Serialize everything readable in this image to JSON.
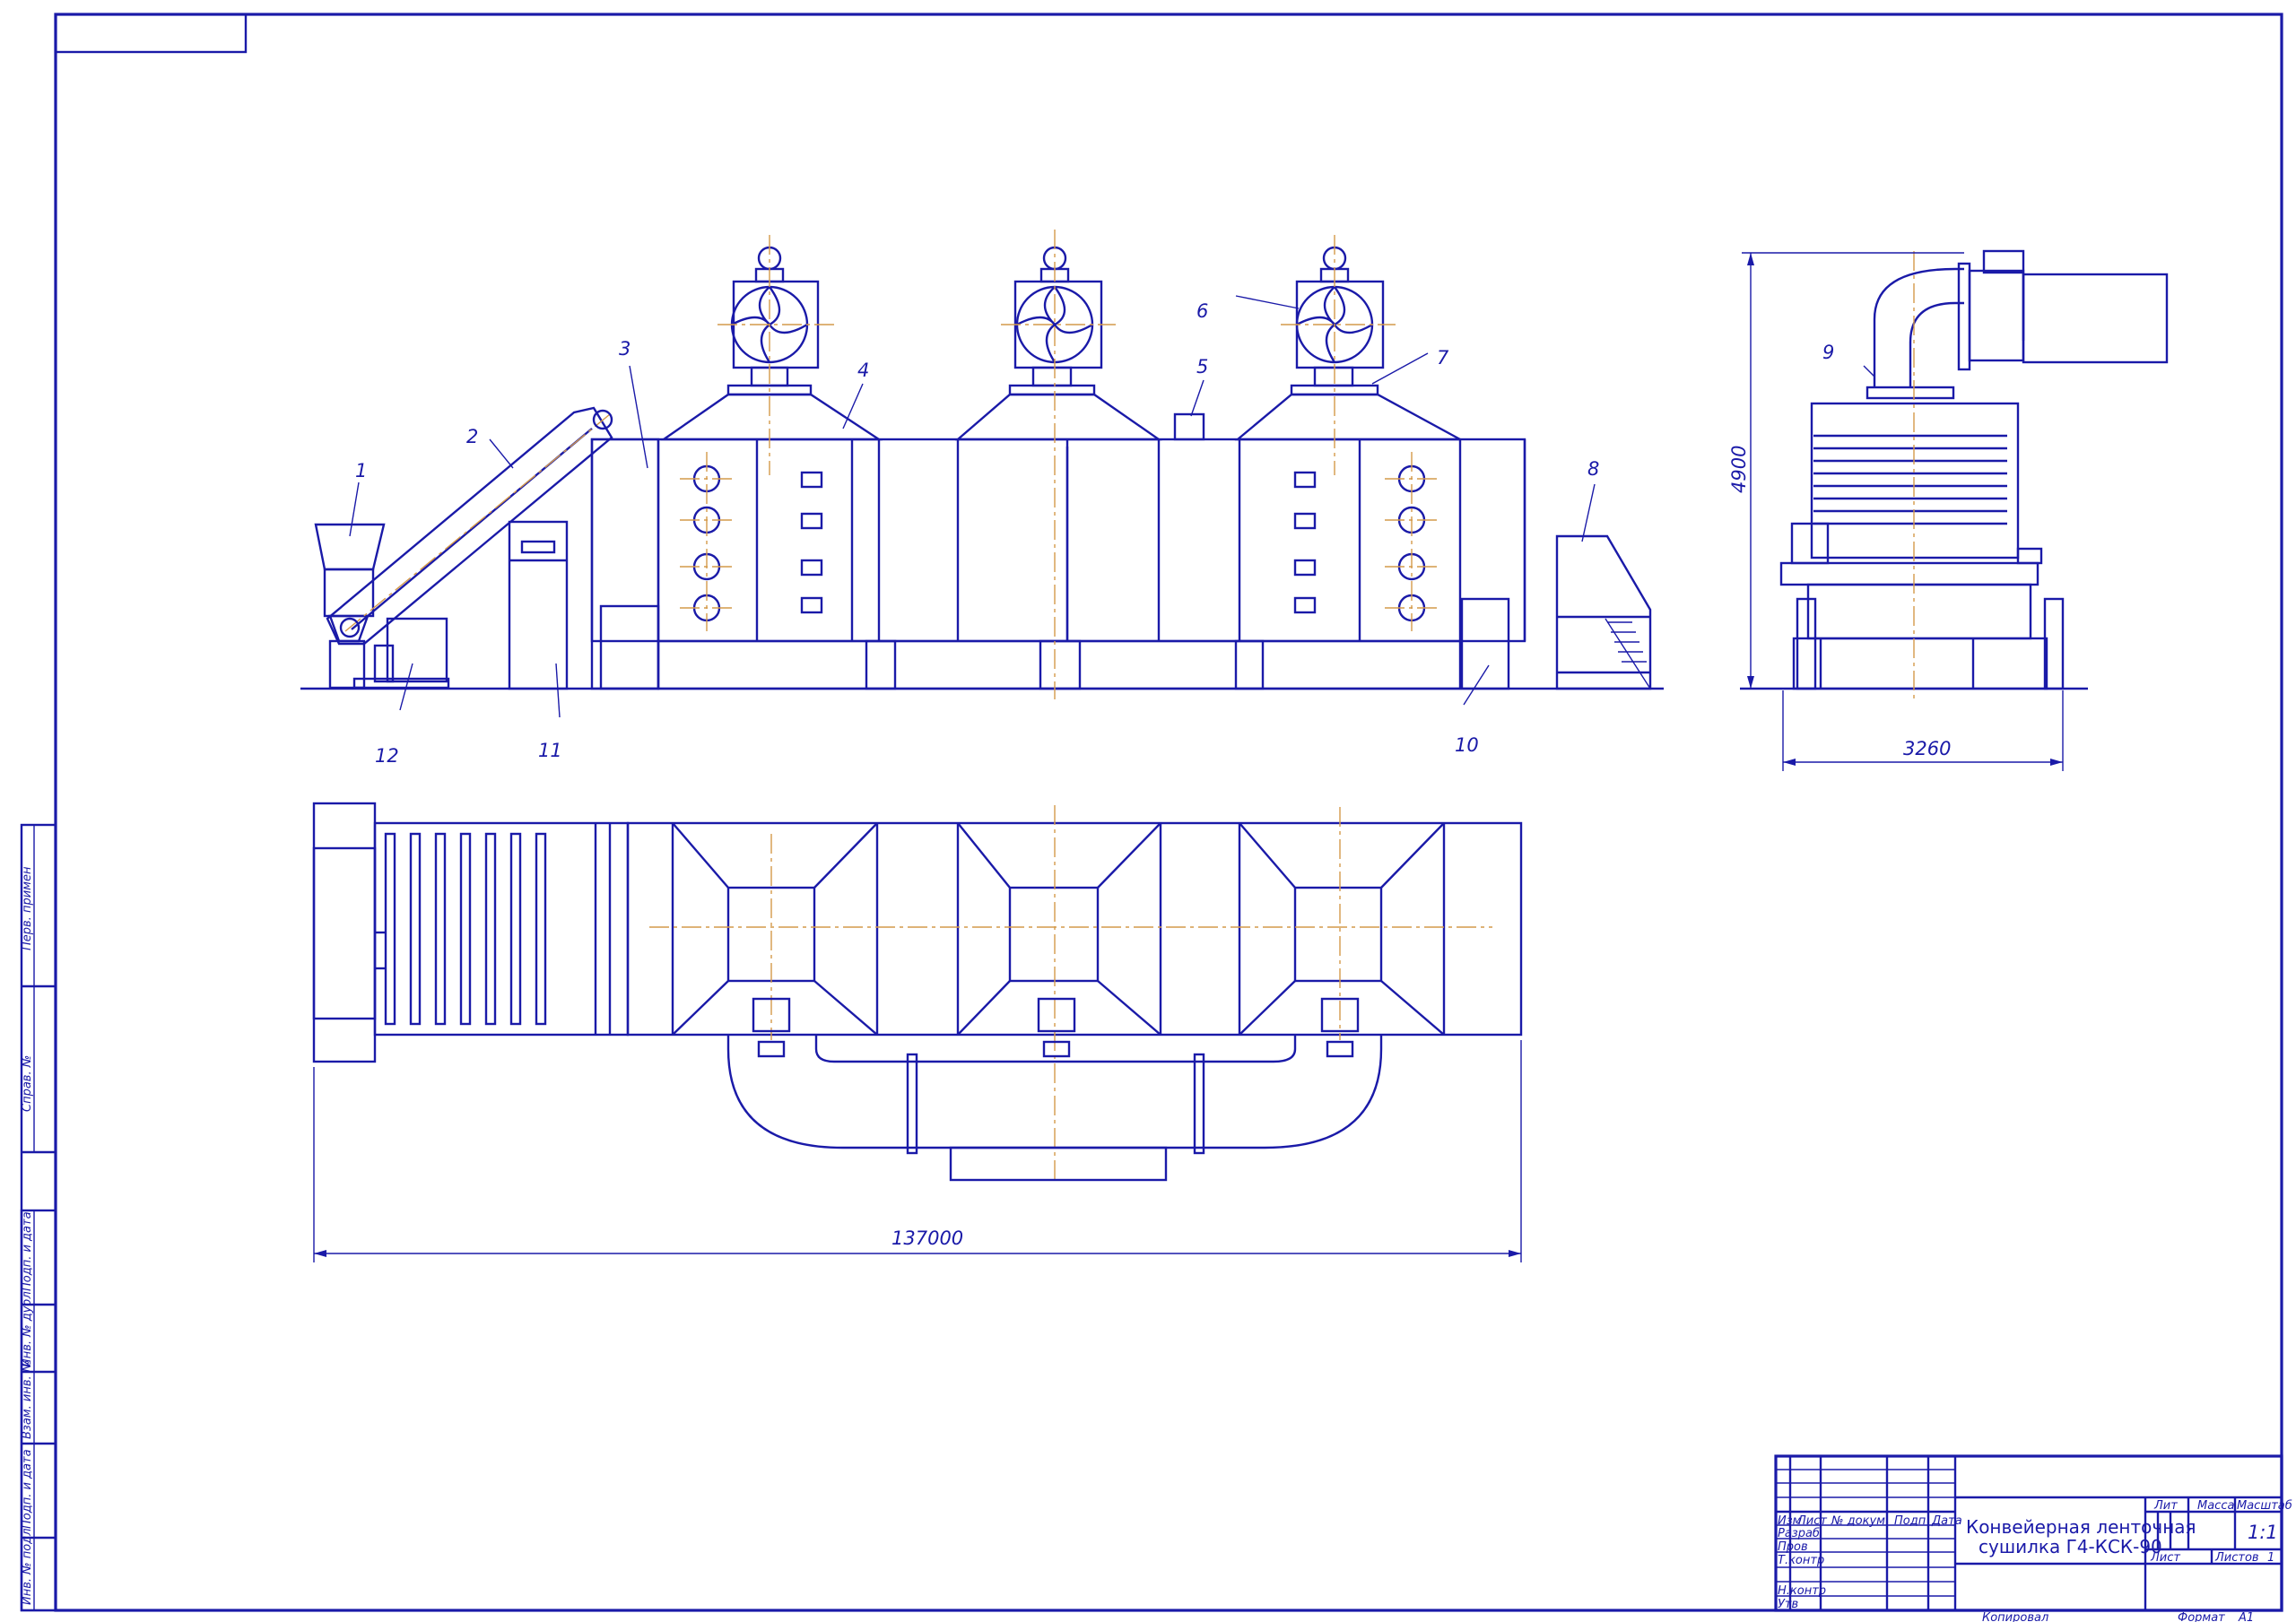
{
  "drawing": {
    "title_line1": "Конвейерная ленточная",
    "title_line2": "сушилка Г4-КСК-90",
    "part_labels": [
      "1",
      "2",
      "3",
      "4",
      "5",
      "6",
      "7",
      "8",
      "9",
      "10",
      "11",
      "12"
    ],
    "dimensions": {
      "plan_length": "137000",
      "side_width": "3260",
      "side_height": "4900"
    }
  },
  "title_block": {
    "col_headers": [
      "Изм",
      "Лист",
      "№ докум",
      "Подп",
      "Дата"
    ],
    "rows": [
      "Разраб",
      "Пров",
      "Т.контр",
      "",
      "Н.контр",
      "Утв"
    ],
    "lit_label": "Лит",
    "mass_label": "Масса",
    "scale_label": "Масштаб",
    "scale_value": "1:1",
    "sheet_label": "Лист",
    "sheets_label": "Листов",
    "sheets_value": "1"
  },
  "footer": {
    "copied": "Копировал",
    "format": "Формат",
    "format_value": "A1"
  },
  "side_stamps": [
    "Перв. примен",
    "Справ. №",
    "Подп. и дата",
    "Инв. № дубл",
    "Взам. инв. №",
    "Подп. и дата",
    "Инв. № подл"
  ],
  "colors": {
    "line": "#1a1aa8",
    "axis": "#d49a4a",
    "paper": "#ffffff"
  }
}
